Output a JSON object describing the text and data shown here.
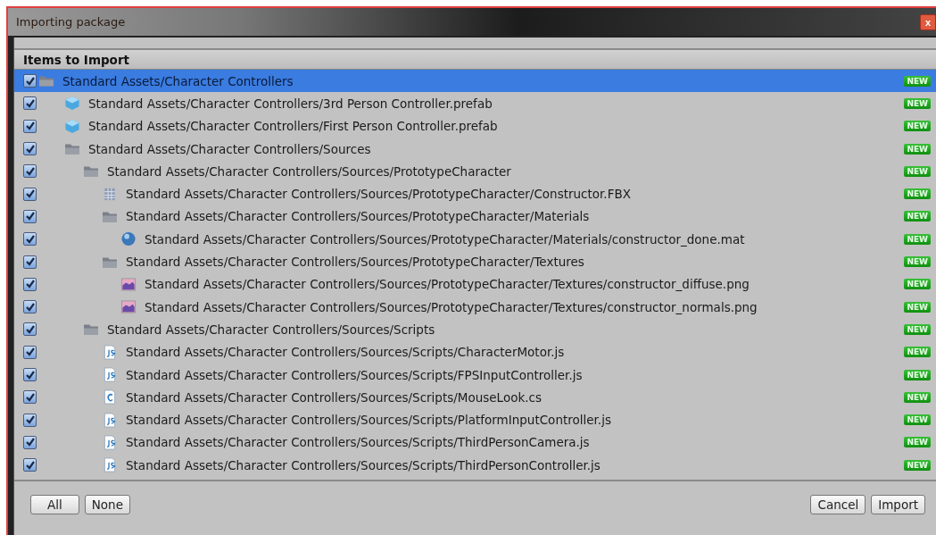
{
  "window": {
    "title": "Importing package",
    "close": "x"
  },
  "list": {
    "header": "Items to Import",
    "items": [
      {
        "kind": "folder",
        "label": "Standard Assets/Character Controllers",
        "checked": true,
        "selected": true,
        "badge": "NEW",
        "children": [
          {
            "kind": "prefab",
            "label": "Standard Assets/Character Controllers/3rd Person Controller.prefab",
            "checked": true,
            "selected": false,
            "badge": "NEW"
          },
          {
            "kind": "prefab",
            "label": "Standard Assets/Character Controllers/First Person Controller.prefab",
            "checked": true,
            "selected": false,
            "badge": "NEW"
          },
          {
            "kind": "folder",
            "label": "Standard Assets/Character Controllers/Sources",
            "checked": true,
            "selected": false,
            "badge": "NEW",
            "children": [
              {
                "kind": "folder",
                "label": "Standard Assets/Character Controllers/Sources/PrototypeCharacter",
                "checked": true,
                "selected": false,
                "badge": "NEW",
                "children": [
                  {
                    "kind": "model",
                    "label": "Standard Assets/Character Controllers/Sources/PrototypeCharacter/Constructor.FBX",
                    "checked": true,
                    "selected": false,
                    "badge": "NEW"
                  },
                  {
                    "kind": "folder",
                    "label": "Standard Assets/Character Controllers/Sources/PrototypeCharacter/Materials",
                    "checked": true,
                    "selected": false,
                    "badge": "NEW",
                    "children": [
                      {
                        "kind": "material",
                        "label": "Standard Assets/Character Controllers/Sources/PrototypeCharacter/Materials/constructor_done.mat",
                        "checked": true,
                        "selected": false,
                        "badge": "NEW"
                      }
                    ]
                  },
                  {
                    "kind": "folder",
                    "label": "Standard Assets/Character Controllers/Sources/PrototypeCharacter/Textures",
                    "checked": true,
                    "selected": false,
                    "badge": "NEW",
                    "children": [
                      {
                        "kind": "texture",
                        "label": "Standard Assets/Character Controllers/Sources/PrototypeCharacter/Textures/constructor_diffuse.png",
                        "checked": true,
                        "selected": false,
                        "badge": "NEW"
                      },
                      {
                        "kind": "texture",
                        "label": "Standard Assets/Character Controllers/Sources/PrototypeCharacter/Textures/constructor_normals.png",
                        "checked": true,
                        "selected": false,
                        "badge": "NEW"
                      }
                    ]
                  }
                ]
              },
              {
                "kind": "folder",
                "label": "Standard Assets/Character Controllers/Sources/Scripts",
                "checked": true,
                "selected": false,
                "badge": "NEW",
                "children": [
                  {
                    "kind": "js",
                    "label": "Standard Assets/Character Controllers/Sources/Scripts/CharacterMotor.js",
                    "checked": true,
                    "selected": false,
                    "badge": "NEW"
                  },
                  {
                    "kind": "js",
                    "label": "Standard Assets/Character Controllers/Sources/Scripts/FPSInputController.js",
                    "checked": true,
                    "selected": false,
                    "badge": "NEW"
                  },
                  {
                    "kind": "cs",
                    "label": "Standard Assets/Character Controllers/Sources/Scripts/MouseLook.cs",
                    "checked": true,
                    "selected": false,
                    "badge": "NEW"
                  },
                  {
                    "kind": "js",
                    "label": "Standard Assets/Character Controllers/Sources/Scripts/PlatformInputController.js",
                    "checked": true,
                    "selected": false,
                    "badge": "NEW"
                  },
                  {
                    "kind": "js",
                    "label": "Standard Assets/Character Controllers/Sources/Scripts/ThirdPersonCamera.js",
                    "checked": true,
                    "selected": false,
                    "badge": "NEW"
                  },
                  {
                    "kind": "js",
                    "label": "Standard Assets/Character Controllers/Sources/Scripts/ThirdPersonController.js",
                    "checked": true,
                    "selected": false,
                    "badge": "NEW"
                  }
                ]
              }
            ]
          }
        ]
      }
    ]
  },
  "buttons_left": [
    "All",
    "None"
  ],
  "buttons_right": [
    "Cancel",
    "Import"
  ]
}
